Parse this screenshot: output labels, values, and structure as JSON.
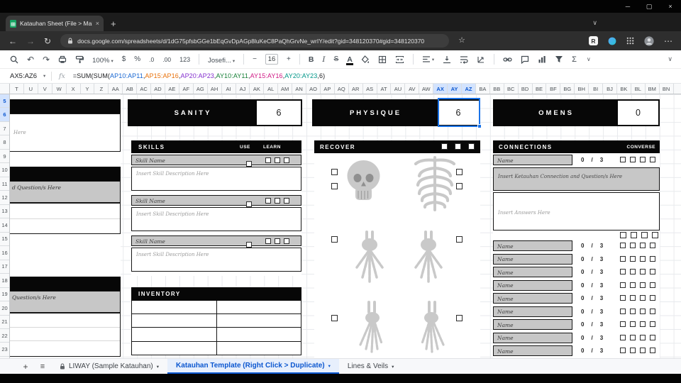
{
  "window_controls": {
    "minimize": "─",
    "maximize": "▢",
    "close": "×"
  },
  "browser": {
    "tab": {
      "title": "Katauhan Sheet (File > Make C",
      "close": "×"
    },
    "new_tab": "+",
    "tab_chevron": "∨",
    "nav": {
      "back": "←",
      "forward": "→",
      "refresh": "↻"
    },
    "url": "docs.google.com/spreadsheets/d/1dG75pfsbGGe1bEqGvDpAGp8luKeC8PaQhGrvNe_wrIY/edit?gid=348120370#gid=348120370",
    "favorites": "☆",
    "extension_badge": "R",
    "more": "⋯"
  },
  "toolbar": {
    "undo": "↶",
    "redo": "↷",
    "zoom": "100%",
    "currency": "$",
    "percent": "%",
    "decimal_decrease": ".0",
    "decimal_increase": ".00",
    "number_format": "123",
    "font": "Josefi...",
    "size_minus": "−",
    "font_size": "16",
    "size_plus": "+",
    "bold": "B",
    "italic": "I",
    "strikethrough": "S",
    "text_color": "A",
    "functions": "Σ",
    "more": "∨",
    "collapse": "∨",
    "dropdown": "▾"
  },
  "formula_bar": {
    "name_box": "AX5:AZ6",
    "fx": "fx",
    "formula_parts": [
      {
        "text": "=SUM(SUM(",
        "color": "#202124"
      },
      {
        "text": "AP10:AP11",
        "color": "#1967d2"
      },
      {
        "text": ",",
        "color": "#202124"
      },
      {
        "text": "AP15:AP16",
        "color": "#e8710a"
      },
      {
        "text": ",",
        "color": "#202124"
      },
      {
        "text": "AP20:AP23",
        "color": "#8430ce"
      },
      {
        "text": ",",
        "color": "#202124"
      },
      {
        "text": "AY10:AY11",
        "color": "#188038"
      },
      {
        "text": ",",
        "color": "#202124"
      },
      {
        "text": "AY15:AY16",
        "color": "#d01884"
      },
      {
        "text": ",",
        "color": "#202124"
      },
      {
        "text": "AY20:AY23",
        "color": "#009688"
      },
      {
        "text": ",6)",
        "color": "#202124"
      }
    ]
  },
  "grid": {
    "columns": [
      "T",
      "U",
      "V",
      "W",
      "X",
      "Y",
      "Z",
      "AA",
      "AB",
      "AC",
      "AD",
      "AE",
      "AF",
      "AG",
      "AH",
      "AI",
      "AJ",
      "AK",
      "AL",
      "AM",
      "AN",
      "AO",
      "AP",
      "AQ",
      "AR",
      "AS",
      "AT",
      "AU",
      "AV",
      "AW",
      "AX",
      "AY",
      "AZ",
      "BA",
      "BB",
      "BC",
      "BD",
      "BE",
      "BF",
      "BG",
      "BH",
      "BI",
      "BJ",
      "BK",
      "BL",
      "BM",
      "BN"
    ],
    "selected_columns": [
      "AX",
      "AY",
      "AZ"
    ],
    "rows": [
      "5",
      "6",
      "7",
      "8",
      "9",
      "10",
      "11",
      "12",
      "13",
      "14",
      "15",
      "16",
      "17",
      "18",
      "19",
      "20",
      "21",
      "22",
      "23"
    ],
    "selected_rows": [
      "5",
      "6"
    ]
  },
  "sheet": {
    "left_panel": {
      "box1": "Here",
      "box2": "d Question/s Here",
      "box3": "Question/s Here"
    },
    "stats": [
      {
        "label": "SANITY",
        "value": "6"
      },
      {
        "label": "PHYSIQUE",
        "value": "6"
      },
      {
        "label": "OMENS",
        "value": "0"
      }
    ],
    "skills": {
      "title": "SKILLS",
      "use_label": "USE",
      "learn_label": "LEARN",
      "rows": [
        {
          "name": "Skill Name",
          "desc": "Insert Skill Description Here"
        },
        {
          "name": "Skill Name",
          "desc": "Insert Skill Description Here"
        },
        {
          "name": "Skill Name",
          "desc": "Insert Skill Description Here"
        }
      ]
    },
    "inventory": {
      "title": "INVENTORY",
      "row_count": 4
    },
    "recover": {
      "title": "RECOVER"
    },
    "connections": {
      "title": "CONNECTIONS",
      "converse_label": "CONVERSE",
      "prompt": "Insert Ketauhan Connection and Question/s Here",
      "answers_placeholder": "Insert Answers Here",
      "top_row": {
        "name": "Name",
        "current": "0",
        "sep": "/",
        "max": "3"
      },
      "rows": [
        {
          "name": "Name",
          "current": "0",
          "sep": "/",
          "max": "3"
        },
        {
          "name": "Name",
          "current": "0",
          "sep": "/",
          "max": "3"
        },
        {
          "name": "Name",
          "current": "0",
          "sep": "/",
          "max": "3"
        },
        {
          "name": "Name",
          "current": "0",
          "sep": "/",
          "max": "3"
        },
        {
          "name": "Name",
          "current": "0",
          "sep": "/",
          "max": "3"
        },
        {
          "name": "Name",
          "current": "0",
          "sep": "/",
          "max": "3"
        },
        {
          "name": "Name",
          "current": "0",
          "sep": "/",
          "max": "3"
        },
        {
          "name": "Name",
          "current": "0",
          "sep": "/",
          "max": "3"
        },
        {
          "name": "Name",
          "current": "0",
          "sep": "/",
          "max": "3"
        }
      ]
    }
  },
  "sheet_tabs": {
    "add": "+",
    "all_sheets": "≡",
    "caret": "▾",
    "tabs": [
      {
        "label": "LIWAY (Sample Katauhan)",
        "locked": true,
        "active": false
      },
      {
        "label": "Katauhan Template (Right Click > Duplicate)",
        "locked": false,
        "active": true
      },
      {
        "label": "Lines & Veils",
        "locked": false,
        "active": false
      }
    ]
  },
  "colors": {
    "selection": "#1a73e8",
    "active_tab": "#0b57d0",
    "section_header": "#070707"
  }
}
